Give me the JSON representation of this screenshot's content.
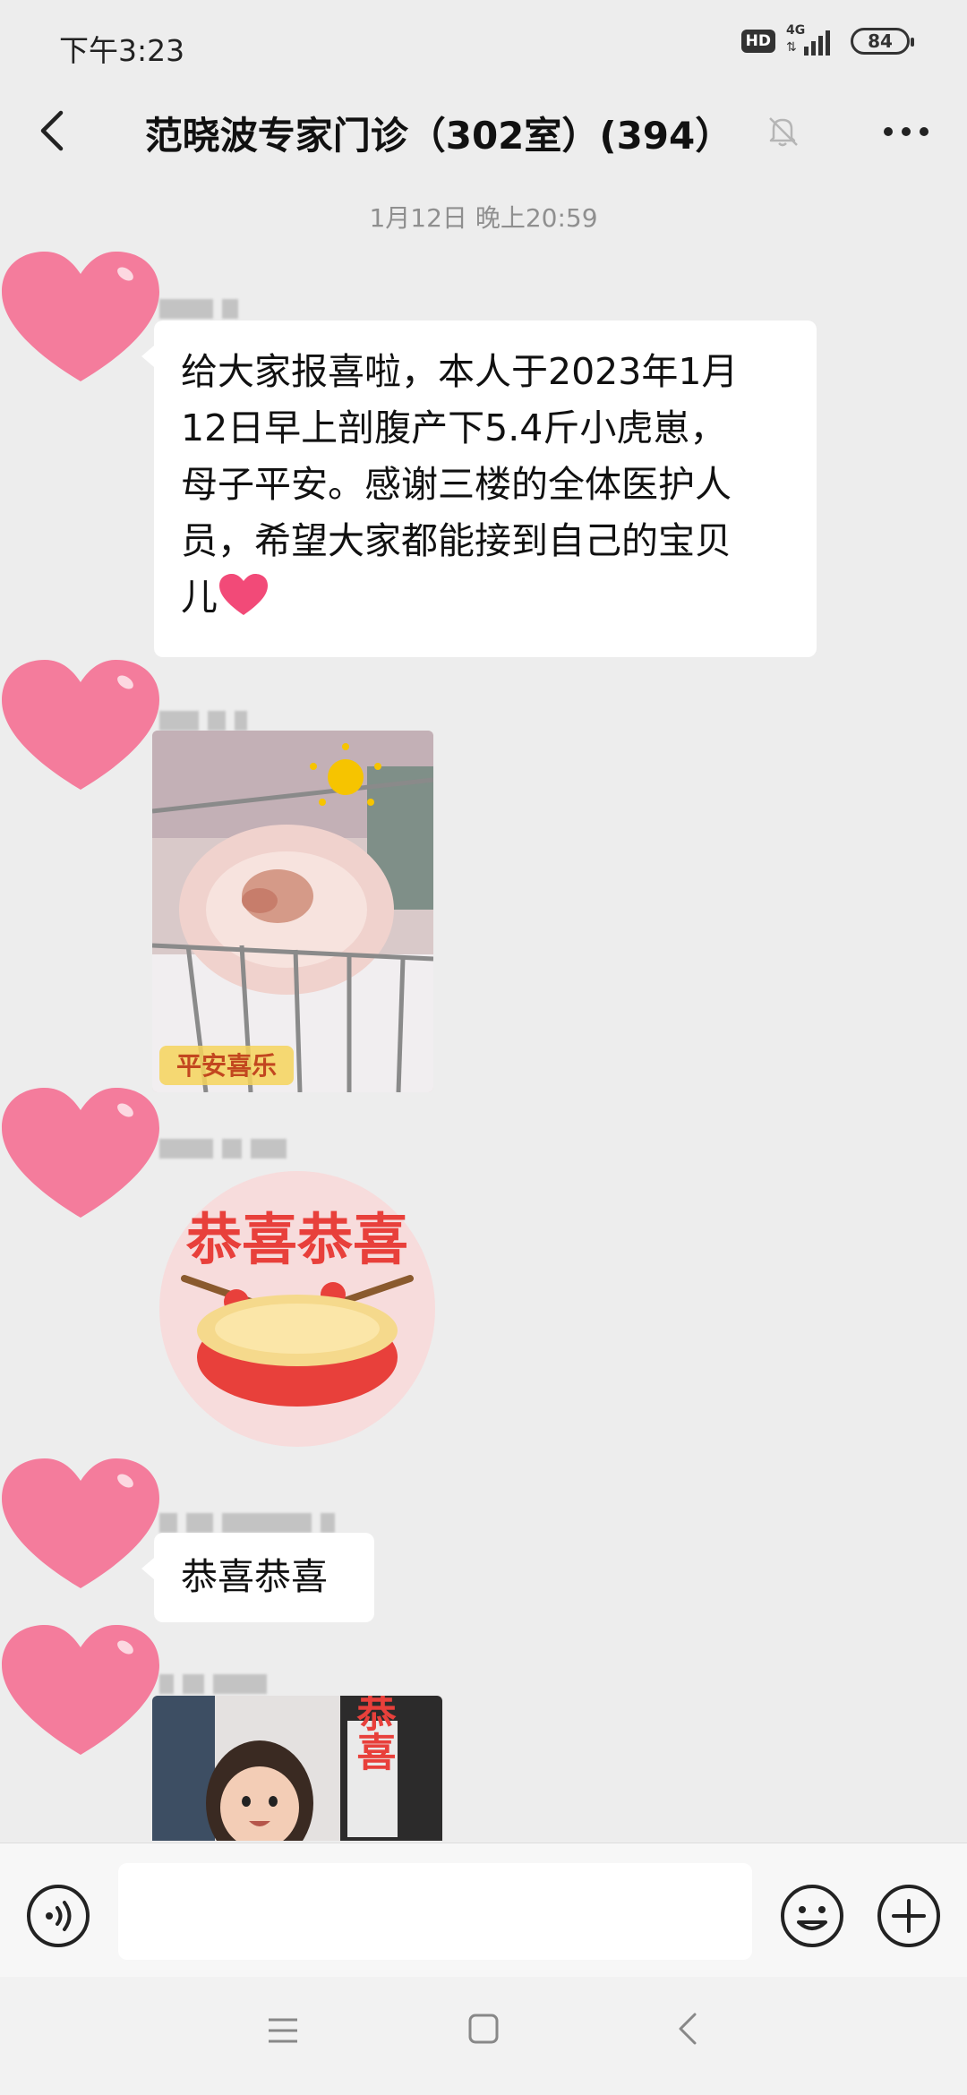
{
  "status_bar": {
    "time": "下午3:23",
    "hd": "HD",
    "network": "4G",
    "battery": "84"
  },
  "header": {
    "title": "范晓波专家门诊（302室）(394）"
  },
  "timestamp": "1月12日 晚上20:59",
  "messages": [
    {
      "type": "text",
      "lines": [
        "给大家报喜啦，本人于2023年1月",
        "12日早上剖腹产下5.4斤小虎崽，",
        "母子平安。感谢三楼的全体医护人",
        "员，希望大家都能接到自己的宝贝",
        "儿"
      ]
    },
    {
      "type": "image",
      "caption": "平安喜乐"
    },
    {
      "type": "sticker",
      "text": "恭喜恭喜"
    },
    {
      "type": "text",
      "text": "恭喜恭喜"
    },
    {
      "type": "image",
      "text": "恭喜"
    }
  ],
  "colors": {
    "background": "#ededed",
    "bubble": "#ffffff",
    "heart": "#f47c9c"
  },
  "icons": {
    "back": "chevron-left-icon",
    "mute": "bell-off-icon",
    "more": "more-dots-icon",
    "voice": "voice-icon",
    "emoji": "emoji-icon",
    "plus": "plus-icon"
  }
}
